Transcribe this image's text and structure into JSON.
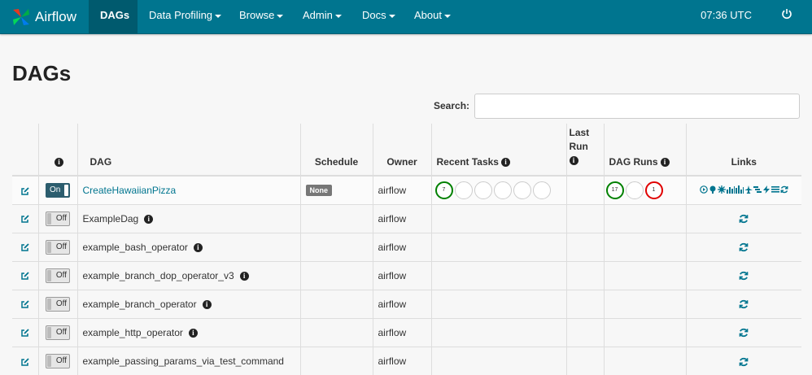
{
  "navbar": {
    "brand": "Airflow",
    "items": [
      {
        "label": "DAGs"
      },
      {
        "label": "Data Profiling"
      },
      {
        "label": "Browse"
      },
      {
        "label": "Admin"
      },
      {
        "label": "Docs"
      },
      {
        "label": "About"
      }
    ],
    "time": "07:36 UTC"
  },
  "page": {
    "title": "DAGs"
  },
  "search": {
    "label": "Search:",
    "value": ""
  },
  "table": {
    "headers": {
      "dag": "DAG",
      "schedule": "Schedule",
      "owner": "Owner",
      "recent_tasks": "Recent Tasks",
      "last_run": "Last Run",
      "dag_runs": "DAG Runs",
      "links": "Links"
    },
    "rows": [
      {
        "toggle": "On",
        "dag": "CreateHawaiianPizza",
        "schedule": "None",
        "owner": "airflow",
        "recent_tasks": [
          "7",
          "",
          "",
          "",
          "",
          ""
        ],
        "dag_runs": [
          "17",
          "",
          "1"
        ]
      },
      {
        "toggle": "Off",
        "dag": "ExampleDag",
        "owner": "airflow"
      },
      {
        "toggle": "Off",
        "dag": "example_bash_operator",
        "owner": "airflow"
      },
      {
        "toggle": "Off",
        "dag": "example_branch_dop_operator_v3",
        "owner": "airflow"
      },
      {
        "toggle": "Off",
        "dag": "example_branch_operator",
        "owner": "airflow"
      },
      {
        "toggle": "Off",
        "dag": "example_http_operator",
        "owner": "airflow"
      },
      {
        "toggle": "Off",
        "dag": "example_passing_params_via_test_command",
        "owner": "airflow"
      }
    ]
  },
  "colors": {
    "navbar": "#00758f",
    "navbar_active": "#005a6e",
    "link": "#00758f",
    "success": "#008000",
    "failed": "#e00000"
  },
  "icons": [
    "airflow-logo-icon",
    "power-icon",
    "edit-icon",
    "info-icon",
    "refresh-icon",
    "trigger-dag-icon",
    "tree-view-icon",
    "graph-view-icon",
    "task-duration-icon",
    "task-tries-icon",
    "landing-times-icon",
    "gantt-icon",
    "code-icon",
    "logs-icon",
    "delete-icon"
  ]
}
